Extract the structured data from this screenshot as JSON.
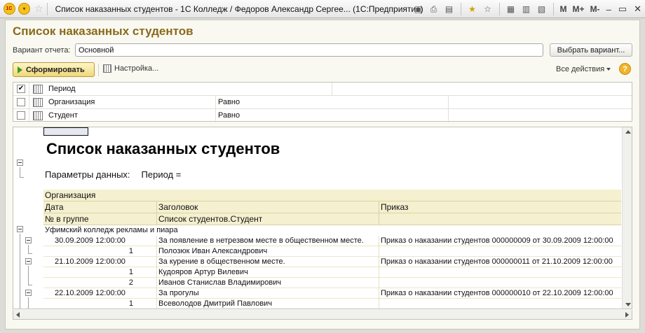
{
  "window": {
    "title": "Список наказанных студентов - 1С Колледж / Федоров Александр Сергее... (1С:Предприятие)",
    "logo_text": "1С",
    "m_buttons": [
      "M",
      "M+",
      "M-"
    ]
  },
  "form": {
    "title": "Список наказанных студентов",
    "variant_label": "Вариант отчета:",
    "variant_value": "Основной",
    "choose_variant_label": "Выбрать вариант...",
    "generate_label": "Сформировать",
    "settings_label": "Настройка...",
    "all_actions_label": "Все действия",
    "help_symbol": "?"
  },
  "settings_rows": [
    {
      "checked": true,
      "check_mark": "✔",
      "field": "Период",
      "condition": ""
    },
    {
      "checked": false,
      "check_mark": "",
      "field": "Организация",
      "condition": "Равно"
    },
    {
      "checked": false,
      "check_mark": "",
      "field": "Студент",
      "condition": "Равно"
    }
  ],
  "report": {
    "title": "Список наказанных студентов",
    "params_label": "Параметры данных:",
    "params_value": "Период =",
    "header": {
      "row1": "Организация",
      "row2": [
        "Дата",
        "Заголовок",
        "Приказ"
      ],
      "row3": [
        "№ в группе",
        "Список студентов.Студент"
      ]
    },
    "organization": "Уфимский колледж рекламы и пиара",
    "groups": [
      {
        "date": "30.09.2009 12:00:00",
        "heading": "За появление в нетрезвом месте в общественном месте.",
        "order": "Приказ о наказании студентов 000000009 от 30.09.2009 12:00:00",
        "students": [
          {
            "num": "1",
            "name": "Полозюк Иван Александрович"
          }
        ]
      },
      {
        "date": "21.10.2009 12:00:00",
        "heading": "За курение в общественном месте.",
        "order": "Приказ о наказании студентов 000000011 от 21.10.2009 12:00:00",
        "students": [
          {
            "num": "1",
            "name": "Кудояров Артур Вилевич"
          },
          {
            "num": "2",
            "name": "Иванов Станислав Владимирович"
          }
        ]
      },
      {
        "date": "22.10.2009 12:00:00",
        "heading": "За прогулы",
        "order": "Приказ о наказании студентов 000000010 от 22.10.2009 12:00:00",
        "students": [
          {
            "num": "1",
            "name": "Всеволодов Дмитрий Павлович"
          }
        ]
      }
    ]
  }
}
